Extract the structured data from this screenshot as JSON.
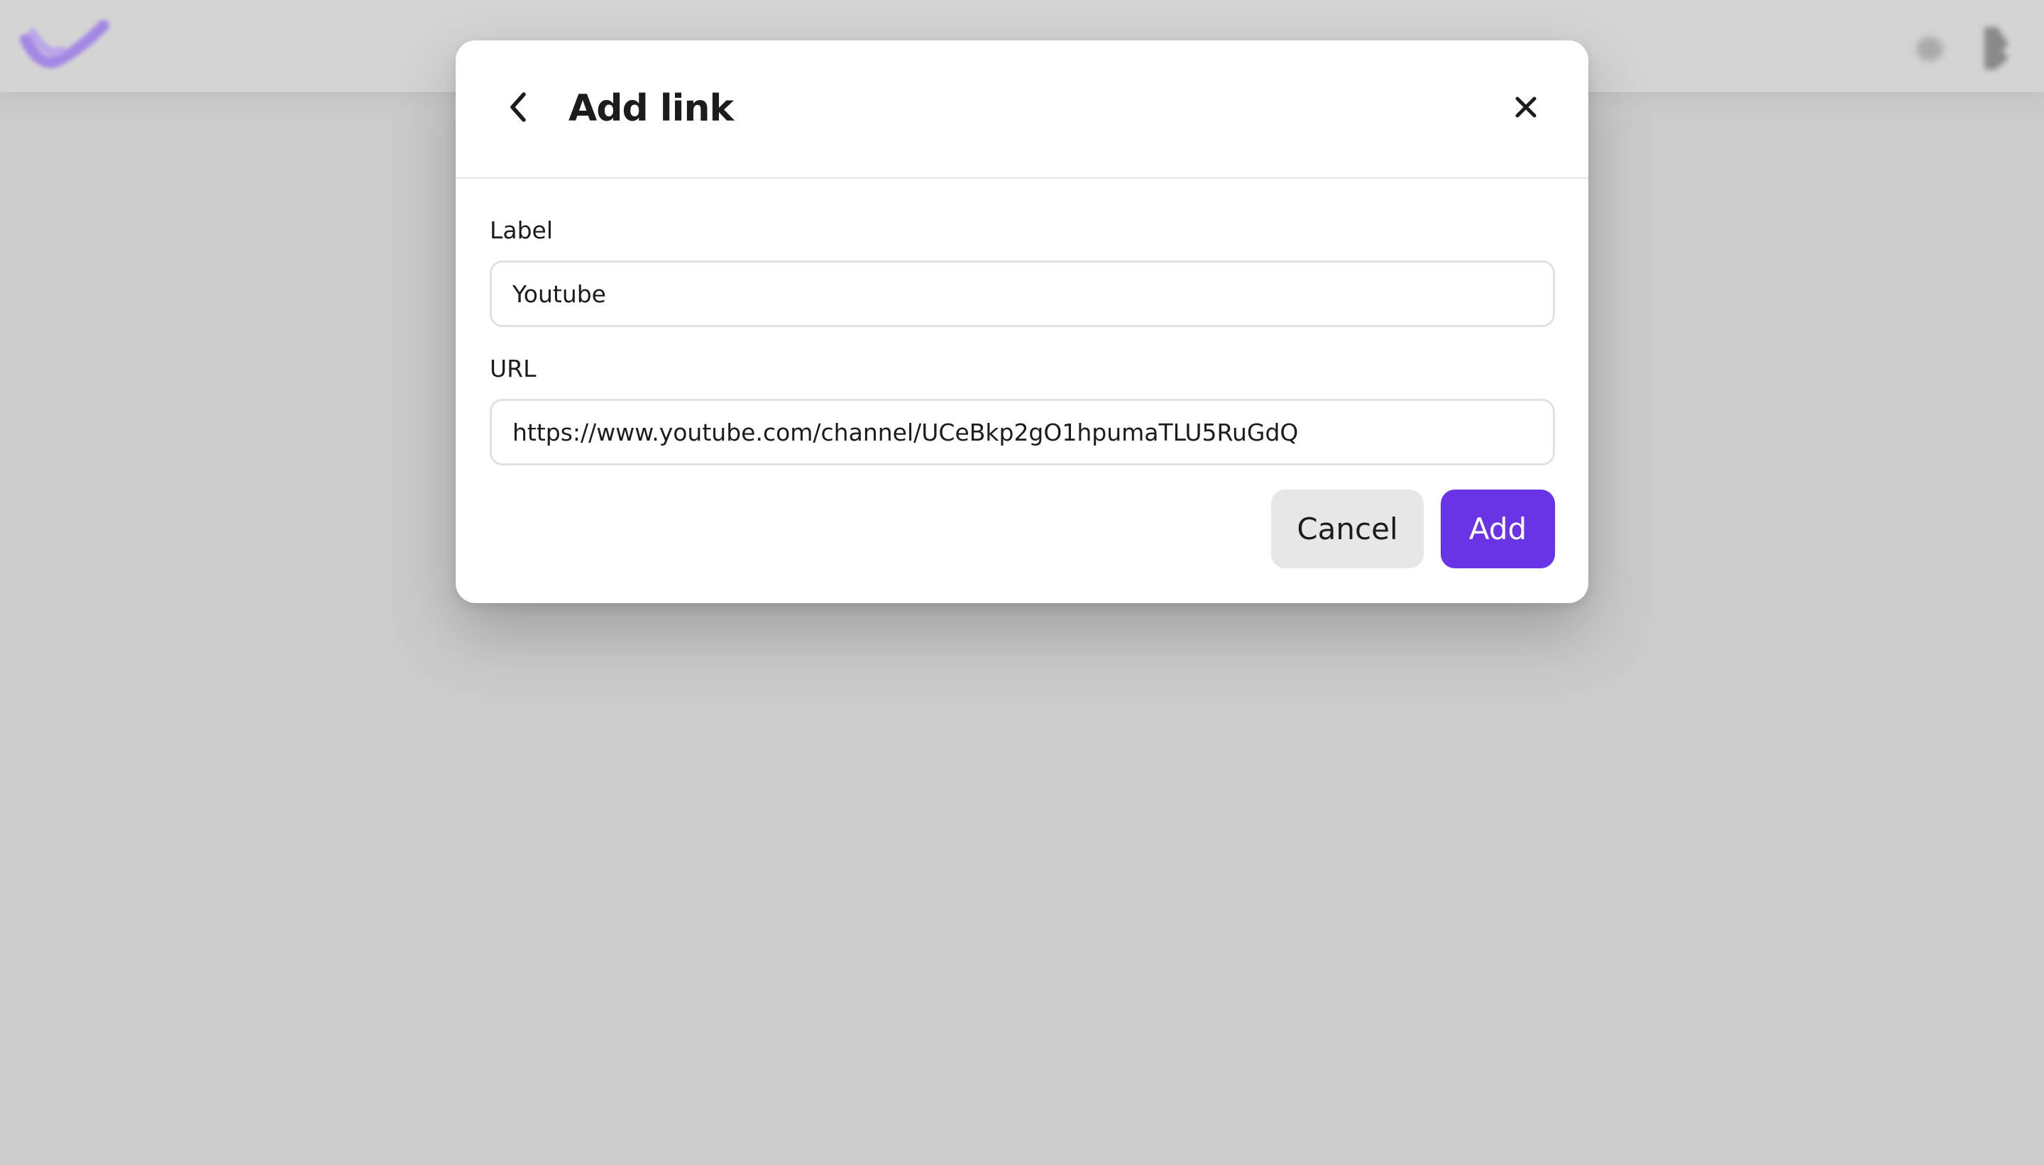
{
  "background": {
    "header_logo_icon": "brand-checkmark-logo",
    "header_icons": [
      "notification-icon",
      "user-avatar"
    ]
  },
  "modal": {
    "title": "Add link",
    "back_icon": "chevron-left-icon",
    "close_icon": "close-icon",
    "fields": {
      "label": {
        "label": "Label",
        "value": "Youtube"
      },
      "url": {
        "label": "URL",
        "value": "https://www.youtube.com/channel/UCeBkp2gO1hpumaTLU5RuGdQ"
      }
    },
    "buttons": {
      "cancel": "Cancel",
      "add": "Add"
    }
  },
  "colors": {
    "accent": "#6a33e6",
    "overlay": "#cbcbcb",
    "cancel_bg": "#e7e7e7"
  }
}
